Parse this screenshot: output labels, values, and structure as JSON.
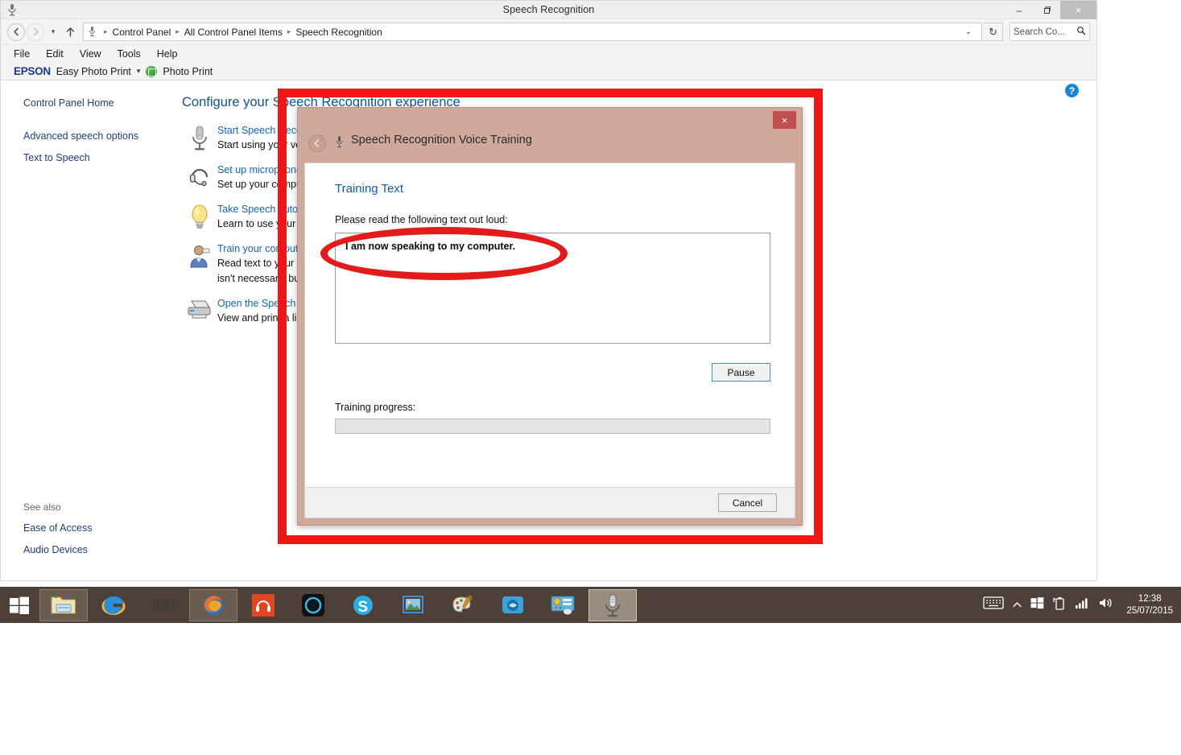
{
  "window": {
    "title": "Speech Recognition",
    "icon": "microphone-icon",
    "minimize_label": "–",
    "maximize_label": "❐",
    "close_label": "×"
  },
  "nav": {
    "back_label": "←",
    "forward_label": "→",
    "recent_label": "▾",
    "up_label": "↑",
    "refresh_label": "↻",
    "address_chevron": "⌄",
    "breadcrumbs": [
      "Control Panel",
      "All Control Panel Items",
      "Speech Recognition"
    ],
    "separator": "▸"
  },
  "search": {
    "value": "Search Co...",
    "placeholder": "Search Control Panel",
    "icon": "magnifier-icon"
  },
  "menubar": {
    "items": [
      "File",
      "Edit",
      "View",
      "Tools",
      "Help"
    ]
  },
  "epson_toolbar": {
    "logo": "EPSON",
    "easy_photo_print": "Easy Photo Print",
    "caret": "▾",
    "photo_print": "Photo Print"
  },
  "sidebar": {
    "home": "Control Panel Home",
    "items": [
      "Advanced speech options",
      "Text to Speech"
    ],
    "see_also_title": "See also",
    "see_also_items": [
      "Ease of Access",
      "Audio Devices"
    ]
  },
  "main": {
    "heading": "Configure your Speech Recognition experience",
    "help_label": "?",
    "tasks": [
      {
        "icon": "microphone-icon",
        "title": "Start Speech Recognition",
        "desc": "Start using your voice"
      },
      {
        "icon": "headset-icon",
        "title": "Set up microphone",
        "desc": "Set up your computer"
      },
      {
        "icon": "lightbulb-icon",
        "title": "Take Speech Tutorial",
        "desc": "Learn to use your co"
      },
      {
        "icon": "user-icon",
        "title": "Train your computer",
        "desc": "Read text to your co\nisn't necessary, but"
      },
      {
        "icon": "printer-icon",
        "title": "Open the Speech Re",
        "desc": "View and print a list"
      }
    ]
  },
  "dialog": {
    "title": "Speech Recognition Voice Training",
    "icon": "microphone-icon",
    "back_label": "‹",
    "close_label": "×",
    "section_title": "Training Text",
    "prompt": "Please read the following text out loud:",
    "training_text": "I am now speaking to my computer.",
    "pause_label": "Pause",
    "progress_label": "Training progress:",
    "progress_percent": 0,
    "cancel_label": "Cancel"
  },
  "annotations": {
    "rectangle_color": "#f01616",
    "oval_color": "#e21b1b"
  },
  "taskbar": {
    "start_label": "start-button",
    "items": [
      {
        "name": "file-explorer",
        "label": "File Explorer"
      },
      {
        "name": "internet-explorer",
        "label": "Internet Explorer"
      },
      {
        "name": "nd-app",
        "label": "ND"
      },
      {
        "name": "firefox",
        "label": "Mozilla Firefox"
      },
      {
        "name": "headphones-app",
        "label": "Headphones"
      },
      {
        "name": "media-player",
        "label": "Media Player"
      },
      {
        "name": "skype",
        "label": "Skype"
      },
      {
        "name": "photo-viewer",
        "label": "Photo Viewer"
      },
      {
        "name": "paint",
        "label": "Paint"
      },
      {
        "name": "scanner-app",
        "label": "Scanner"
      },
      {
        "name": "control-panel-app",
        "label": "Control Panel"
      },
      {
        "name": "speech-recognition-app",
        "label": "Speech Recognition"
      }
    ],
    "tray": {
      "keyboard_icon": "keyboard-icon",
      "show_hidden": "▲",
      "windows_icon": "windows-icon",
      "battery_icon": "battery-icon",
      "network_icon": "signal-icon",
      "volume_icon": "speaker-icon",
      "time": "12:38",
      "date": "25/07/2015"
    }
  }
}
